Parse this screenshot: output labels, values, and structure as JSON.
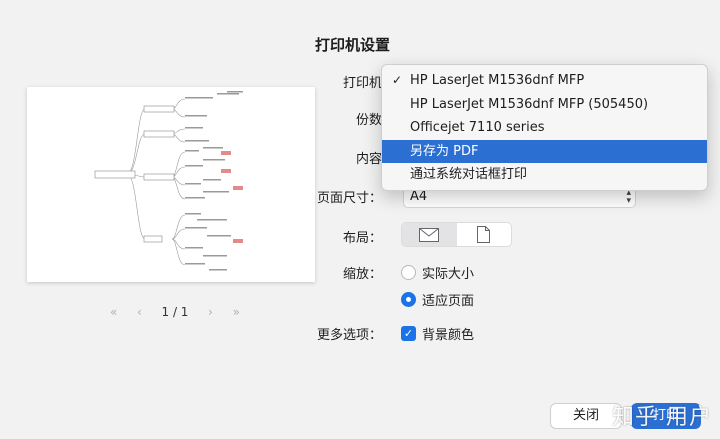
{
  "dialog": {
    "title": "打印机设置"
  },
  "labels": {
    "printer": "打印机",
    "copies": "份数",
    "content": "内容",
    "paper_size": "页面尺寸：",
    "layout": "布局：",
    "scale": "缩放：",
    "more_options": "更多选项："
  },
  "printer_menu": {
    "items": [
      {
        "label": "HP LaserJet M1536dnf MFP",
        "checked": true,
        "highlighted": false
      },
      {
        "label": "HP LaserJet M1536dnf MFP (505450)",
        "checked": false,
        "highlighted": false
      },
      {
        "label": "Officejet 7110 series",
        "checked": false,
        "highlighted": false
      },
      {
        "label": "另存为 PDF",
        "checked": false,
        "highlighted": true
      },
      {
        "label": "通过系统对话框打印",
        "checked": false,
        "highlighted": false
      }
    ],
    "check_glyph": "✓"
  },
  "paper_size": {
    "value": "A4"
  },
  "layout": {
    "options": [
      "landscape-icon",
      "portrait-icon"
    ],
    "selected": 0
  },
  "scale": {
    "options": [
      {
        "label": "实际大小",
        "selected": false
      },
      {
        "label": "适应页面",
        "selected": true
      }
    ]
  },
  "more_options": {
    "background_colors_label": "背景颜色",
    "checked": true
  },
  "pager": {
    "first": "«",
    "prev": "‹",
    "count": "1 / 1",
    "next": "›",
    "last": "»"
  },
  "buttons": {
    "close": "关闭",
    "print": "打印"
  },
  "watermark": "知乎 用户",
  "colors": {
    "accent": "#2b6fd3",
    "background": "#f2f2f2"
  }
}
